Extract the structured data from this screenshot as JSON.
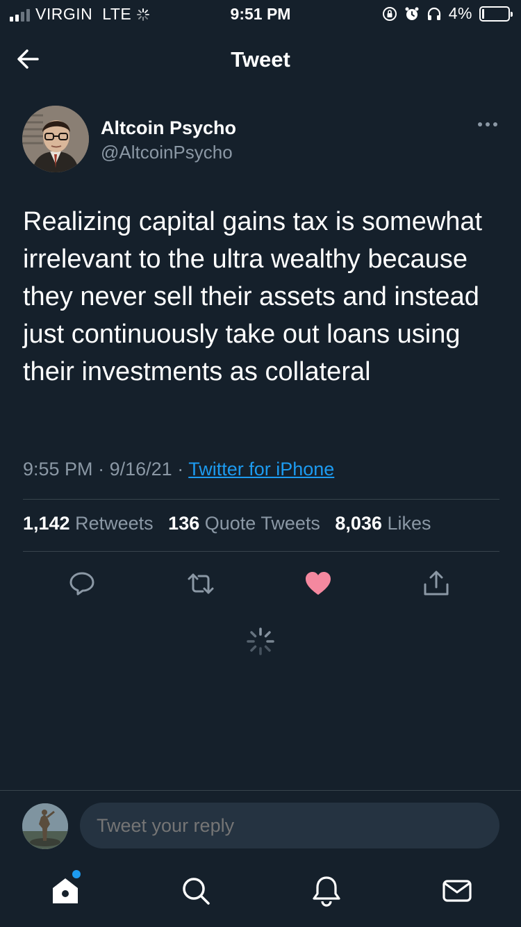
{
  "status_bar": {
    "carrier": "VIRGIN",
    "network": "LTE",
    "time": "9:51 PM",
    "battery": "4%"
  },
  "header": {
    "title": "Tweet",
    "back_icon": "arrow-left-icon"
  },
  "author": {
    "name": "Altcoin Psycho",
    "handle": "@AltcoinPsycho",
    "more_icon": "more-horizontal-icon"
  },
  "tweet": {
    "text": "Realizing capital gains tax is somewhat irrelevant to the ultra wealthy because they never sell their assets and instead just continuously take out loans using their investments as collateral",
    "time": "9:55 PM",
    "date": "9/16/21",
    "source": "Twitter for iPhone"
  },
  "stats": {
    "retweets_count": "1,142",
    "retweets_label": "Retweets",
    "quotes_count": "136",
    "quotes_label": "Quote Tweets",
    "likes_count": "8,036",
    "likes_label": "Likes"
  },
  "actions": {
    "reply_icon": "reply-icon",
    "retweet_icon": "retweet-icon",
    "like_icon": "heart-icon",
    "share_icon": "share-icon"
  },
  "reply_bar": {
    "placeholder": "Tweet your reply"
  },
  "tabbar": {
    "items": [
      "home-icon",
      "search-icon",
      "bell-icon",
      "mail-icon"
    ]
  },
  "colors": {
    "background": "#15202b",
    "accent": "#1d9bf0",
    "like": "#f91880",
    "secondary_text": "#8b98a5"
  }
}
